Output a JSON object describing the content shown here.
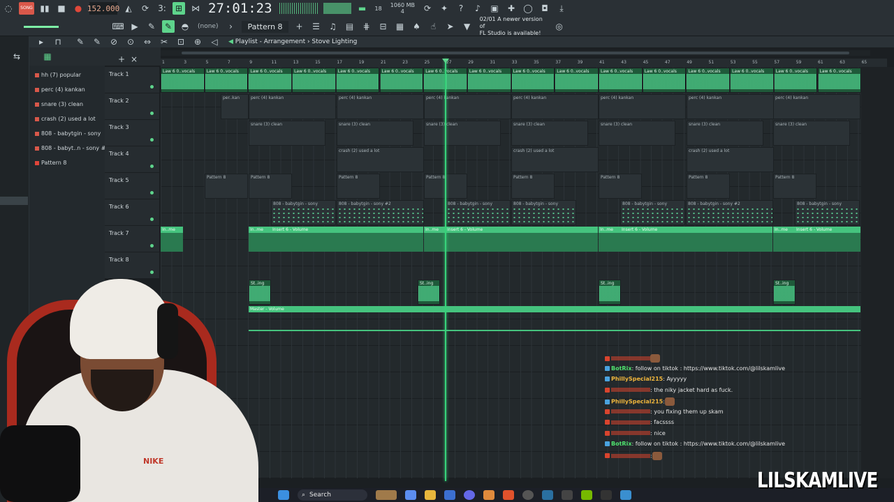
{
  "toolbar": {
    "bpm": "152.000",
    "timecode": "27:01:23",
    "pattern": "Pattern 8",
    "none_label": "(none)",
    "mem_top": "1060 MB",
    "mem_bottom": "4",
    "cpu": "18",
    "news_line1": "02/01 A newer version of",
    "news_line2": "FL Studio is available!",
    "mode_label": "SONG"
  },
  "playlist": {
    "window_title": "Playlist - Arrangement",
    "breadcrumb_sep": "›",
    "arrangement_name": "Stove Lighting",
    "ruler_ticks": [
      "1",
      "3",
      "5",
      "7",
      "9",
      "11",
      "13",
      "15",
      "17",
      "19",
      "21",
      "23",
      "25",
      "27",
      "29",
      "31",
      "33",
      "35",
      "37",
      "39",
      "41",
      "43",
      "45",
      "47",
      "49",
      "51",
      "53",
      "55",
      "57",
      "59",
      "61",
      "63",
      "65"
    ]
  },
  "browser": {
    "items": [
      "hh (7) popular",
      "perc (4) kankan",
      "snare (3) clean",
      "crash (2) used a lot",
      "808 - babytgin - sony",
      "808 - babyt..n - sony #2",
      "Pattern 8"
    ]
  },
  "tracks": [
    "Track 1",
    "Track 2",
    "Track 3",
    "Track 4",
    "Track 5",
    "Track 6",
    "Track 7",
    "Track 8"
  ],
  "clips": {
    "vocals": "Law 6 0..vocals",
    "perc": "perc (4) kankan",
    "perc_short": "per..kan",
    "snare": "snare (3) clean",
    "crash": "crash (2) used a lot",
    "pattern": "Pattern 8",
    "b808_a": "808 - babytgin - sony",
    "b808_b": "808 - babytgin - sony #2",
    "insert_short": "In..me",
    "insert": "Insert 6 - Volume",
    "stab": "St..ing",
    "master": "Master - Volume"
  },
  "chat": {
    "messages": [
      {
        "user": "",
        "text": "",
        "emote": true
      },
      {
        "user": "BotRix",
        "text": ": follow on tiktok : https://www.tiktok.com/@lilskamlive"
      },
      {
        "user": "PhillySpecial215",
        "text": ": Ayyyyy"
      },
      {
        "user": "",
        "text": ": the niky jacket hard as fuck."
      },
      {
        "user": "PhillySpecial215",
        "text": ":",
        "emote": true
      },
      {
        "user": "",
        "text": ": you fixing them up skam"
      },
      {
        "user": "",
        "text": ": facssss"
      },
      {
        "user": "",
        "text": ": nice"
      },
      {
        "user": "BotRix",
        "text": ": follow on tiktok : https://www.tiktok.com/@lilskamlive"
      },
      {
        "user": "",
        "text": ":",
        "emote": true
      }
    ]
  },
  "taskbar": {
    "search_label": "Search"
  },
  "watermark": "LILSKAMLIVE",
  "webcam": {
    "shirt_logo": "NIKE"
  },
  "colors": {
    "accent": "#5ed48c",
    "playhead": "#37d27a",
    "botrix": "#4fe36e",
    "philly": "#f0b63c",
    "redacted": "#d9442e"
  }
}
